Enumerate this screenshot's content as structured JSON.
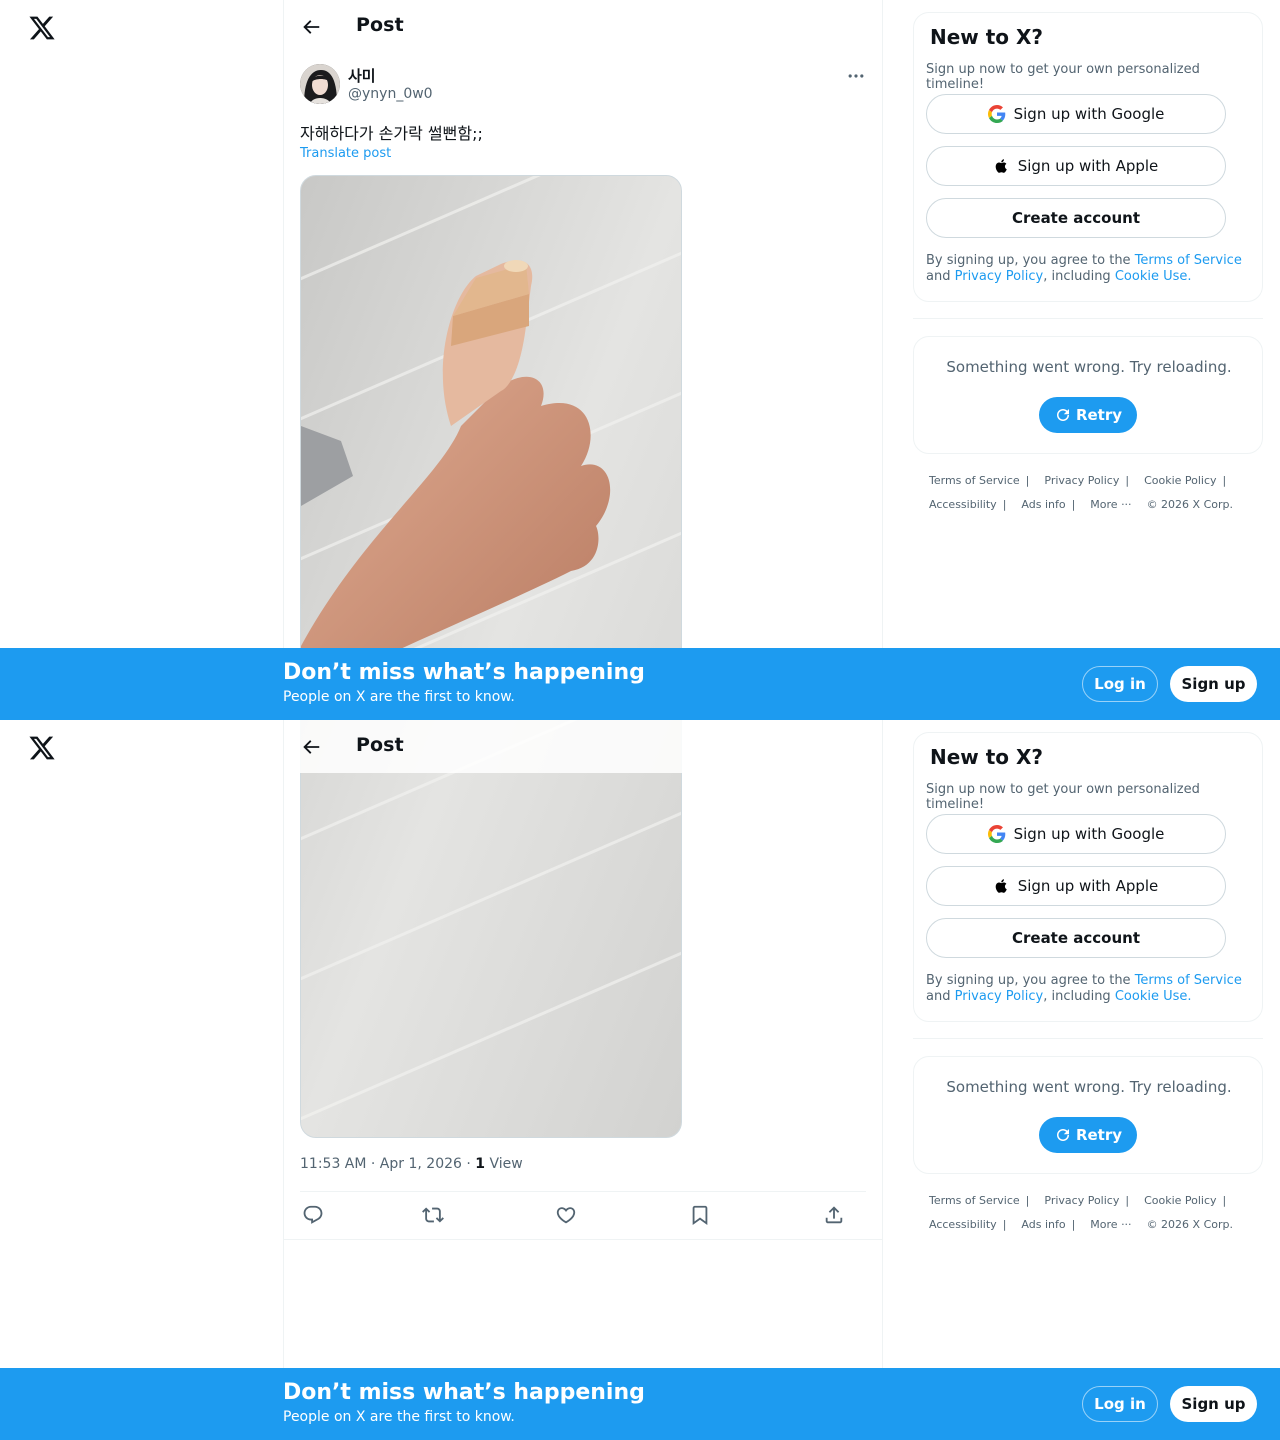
{
  "header": {
    "title": "Post"
  },
  "post": {
    "display_name": "사미",
    "handle": "@ynyn_0w0",
    "text": "자해하다가 손가락 썰뻔함;;",
    "translate_label": "Translate post",
    "image_description": "Hand giving thumbs up with bandaged thumb",
    "timestamp": "11:53 AM · Apr 1, 2026",
    "meta_separator": "·",
    "views_count": "1",
    "views_label": "View"
  },
  "sidebar": {
    "signup_title": "New to X?",
    "signup_subtitle": "Sign up now to get your own personalized timeline!",
    "google_label": "Sign up with Google",
    "apple_label": "Sign up with Apple",
    "create_label": "Create account",
    "legal_prefix": "By signing up, you agree to the",
    "terms_label": "Terms of Service",
    "legal_and": "and",
    "privacy_label": "Privacy Policy",
    "legal_including": ", including",
    "cookie_label": "Cookie Use.",
    "error_text": "Something went wrong. Try reloading.",
    "retry_label": "Retry"
  },
  "footer": {
    "terms": "Terms of Service",
    "privacy": "Privacy Policy",
    "cookie": "Cookie Policy",
    "accessibility": "Accessibility",
    "ads": "Ads info",
    "more": "More ···",
    "copyright": "© 2026 X Corp.",
    "separator": "|"
  },
  "banner": {
    "title": "Don’t miss what’s happening",
    "subtitle": "People on X are the first to know.",
    "login_label": "Log in",
    "signup_label": "Sign up"
  },
  "colors": {
    "accent": "#1d9bf0",
    "text_primary": "#0f1419",
    "text_secondary": "#536471",
    "border": "#eff3f4"
  },
  "icons": [
    "x-logo-icon",
    "back-arrow-icon",
    "more-icon",
    "reply-icon",
    "repost-icon",
    "like-icon",
    "bookmark-icon",
    "share-icon",
    "google-icon",
    "apple-icon",
    "refresh-icon"
  ]
}
